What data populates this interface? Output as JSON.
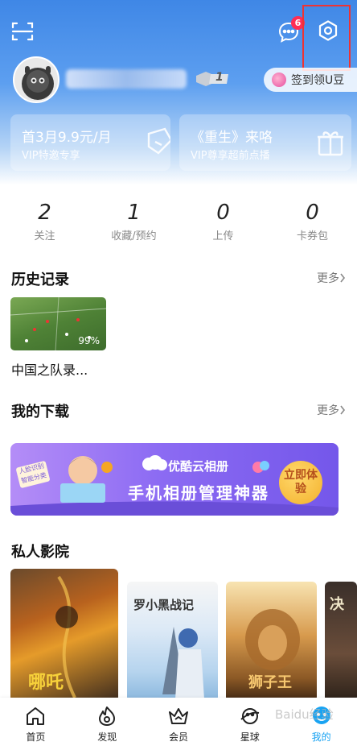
{
  "header": {
    "message_badge_count": "6",
    "checkin_label": "签到领U豆",
    "level": "1"
  },
  "vip_cards": [
    {
      "title": "首3月9.9元/月",
      "subtitle": "VIP特邀专享"
    },
    {
      "title": "《重生》来咯",
      "subtitle": "VIP尊享超前点播"
    }
  ],
  "stats": [
    {
      "value": "2",
      "label": "关注"
    },
    {
      "value": "1",
      "label": "收藏/预约"
    },
    {
      "value": "0",
      "label": "上传"
    },
    {
      "value": "0",
      "label": "卡券包"
    }
  ],
  "history": {
    "title": "历史记录",
    "more_label": "更多",
    "items": [
      {
        "title": "中国之队录...",
        "progress": "99%"
      }
    ]
  },
  "downloads": {
    "title": "我的下载",
    "more_label": "更多",
    "banner": {
      "brand": "优酷云相册",
      "headline": "手机相册管理神器",
      "cta": "立即体验",
      "tag": "人脸识别 智能分类"
    }
  },
  "cinema": {
    "title": "私人影院",
    "posters": [
      {
        "title": "哪吒"
      },
      {
        "title": "罗小黑战记"
      },
      {
        "title": "狮子王"
      },
      {
        "title": "决"
      }
    ]
  },
  "tabbar": {
    "items": [
      {
        "label": "首页",
        "icon": "home-icon"
      },
      {
        "label": "发现",
        "icon": "flame-icon"
      },
      {
        "label": "会员",
        "icon": "crown-icon"
      },
      {
        "label": "星球",
        "icon": "planet-icon"
      },
      {
        "label": "我的",
        "icon": "profile-icon"
      }
    ],
    "active_index": 4
  },
  "watermark": "Baidu经验",
  "colors": {
    "accent_blue": "#19a3f2",
    "badge_red": "#ff2d55",
    "banner_purple": "#8c6bf3"
  }
}
